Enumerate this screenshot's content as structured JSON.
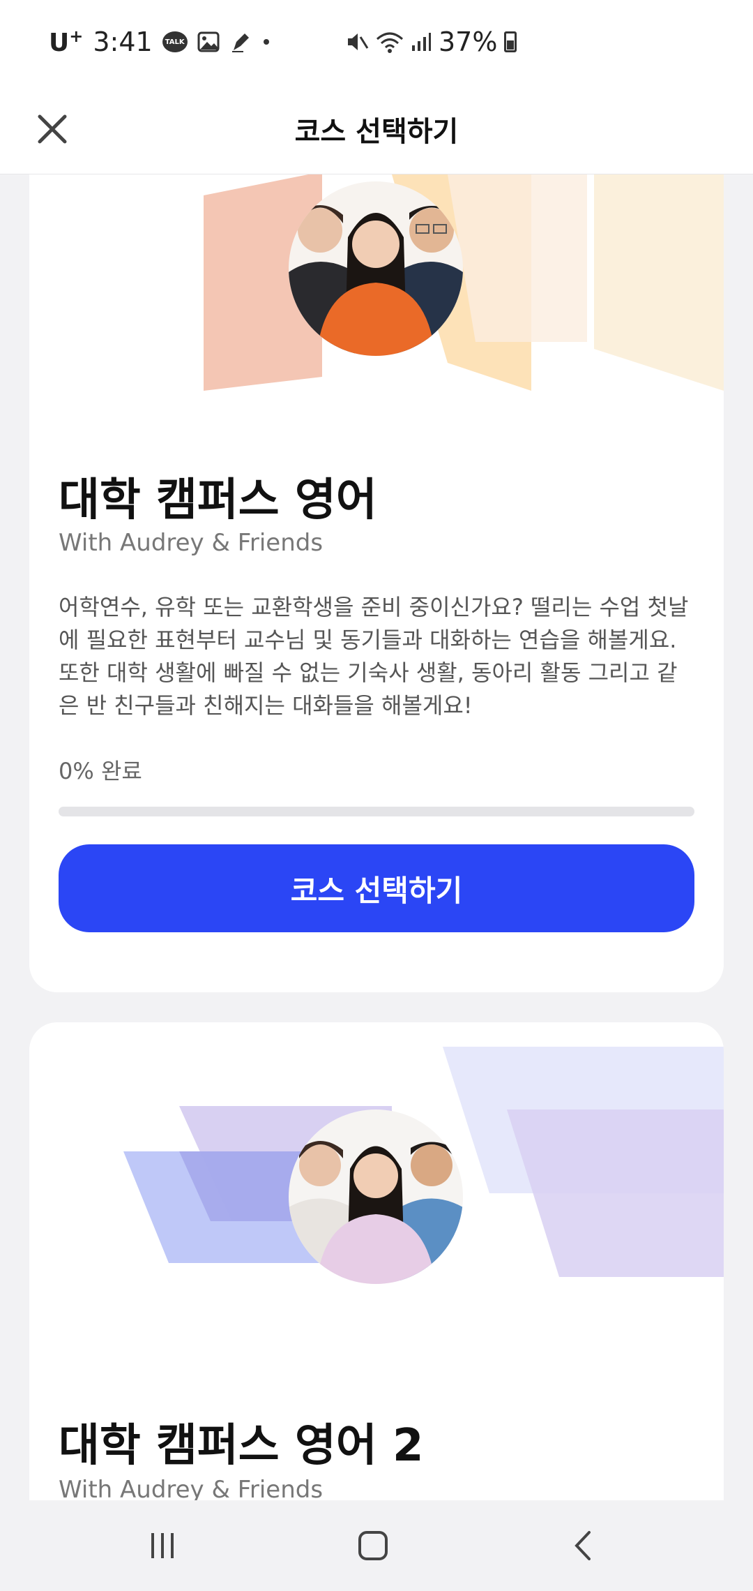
{
  "status_bar": {
    "carrier": "U",
    "carrier_sup": "+",
    "time": "3:41",
    "talk_badge": "TALK",
    "battery": "37%"
  },
  "header": {
    "title": "코스 선택하기",
    "close_icon": "close-icon"
  },
  "courses": [
    {
      "title": "대학 캠퍼스 영어",
      "subtitle": "With Audrey & Friends",
      "description": " 어학연수, 유학 또는 교환학생을 준비 중이신가요? 떨리는 수업 첫날에 필요한 표현부터 교수님 및 동기들과 대화하는 연습을 해볼게요. 또한 대학 생활에 빠질 수 없는 기숙사 생활, 동아리 활동 그리고 같은 반 친구들과 친해지는 대화들을 해볼게요!",
      "progress_label": "0% 완료",
      "progress": 0,
      "button_label": "코스 선택하기",
      "accent_colors": [
        "#f4c6b4",
        "#fde2b8",
        "#fbf0dc"
      ]
    },
    {
      "title": "대학 캠퍼스 영어 2",
      "subtitle": "With Audrey & Friends",
      "accent_colors": [
        "#b8c2f7",
        "#d8d0f2",
        "#e6e8fb"
      ]
    }
  ],
  "nav_bar": {
    "recents_icon": "recent-apps-icon",
    "home_icon": "home-icon",
    "back_icon": "back-icon"
  },
  "colors": {
    "primary": "#2b46f5",
    "background": "#f2f2f4"
  }
}
